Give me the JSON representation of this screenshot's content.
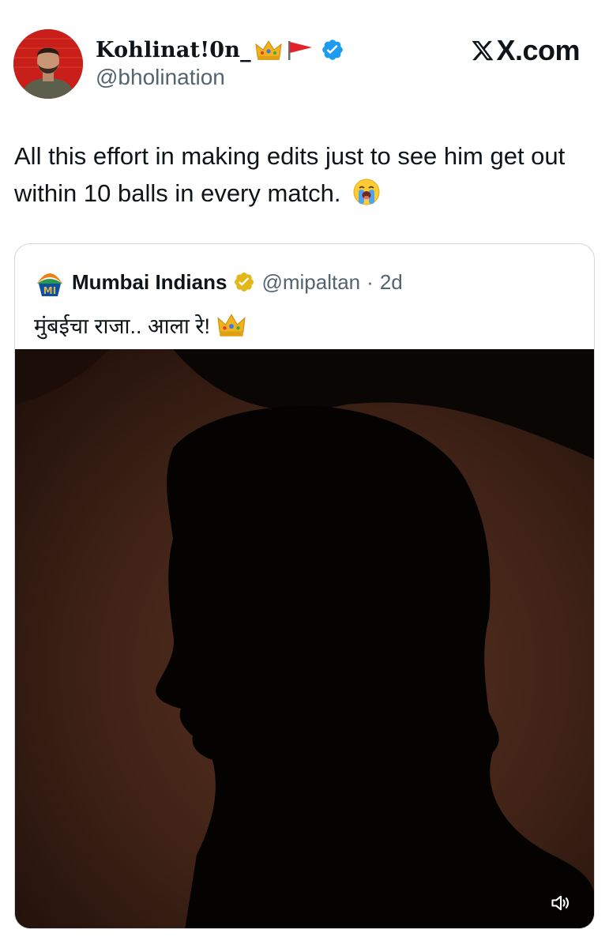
{
  "tweet": {
    "author": {
      "display_name": "Kohlinat!0n_",
      "handle": "@bholination",
      "verified": true,
      "name_emojis": [
        "crown-emoji",
        "red-flag-emoji"
      ],
      "avatar": "avatar-photo"
    },
    "brand": "X.com",
    "text": "All this effort in making edits just to see him get out within 10 balls in every match.",
    "text_emoji": "loudly-crying-face-emoji"
  },
  "quote": {
    "author": {
      "display_name": "Mumbai Indians",
      "handle": "@mipaltan",
      "separator": "·",
      "time": "2d",
      "logo": "mumbai-indians-logo",
      "verified": "gold-badge"
    },
    "text": "मुंबईचा राजा.. आला रे!",
    "text_emoji": "crown-emoji",
    "media": {
      "type": "video",
      "description_icon": "silhouette-video",
      "controls": [
        "mute-icon"
      ]
    }
  },
  "colors": {
    "text_primary": "#0f1419",
    "text_secondary": "#536471",
    "verified_blue": "#1d9bf0",
    "gold_badge": "#e2b719",
    "card_border": "#cfd9de",
    "avatar_bg": "#c81f1a"
  }
}
